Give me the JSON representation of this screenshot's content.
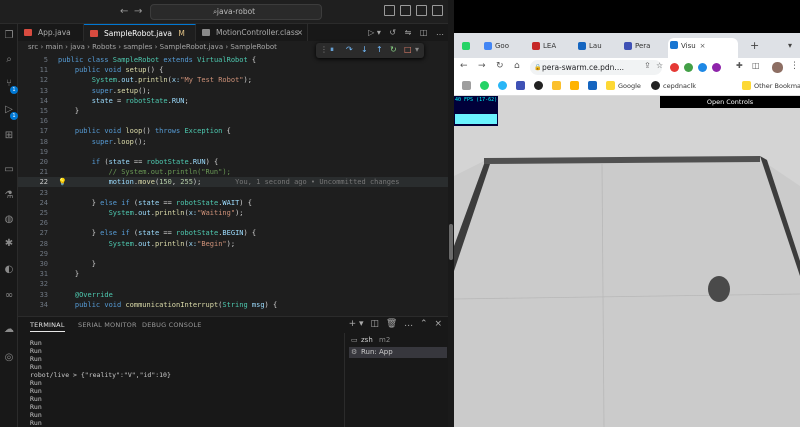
{
  "vscode": {
    "search_text": "java-robot",
    "tabs": [
      {
        "label": "App.java",
        "modified": ""
      },
      {
        "label": "SampleRobot.java",
        "modified": "M"
      },
      {
        "label": "MotionController.class",
        "modified": ""
      }
    ],
    "breadcrumb": "src › main › java › Robots › samples › SampleRobot.java › SampleRobot",
    "activity_badges": {
      "source_control": "1",
      "run": "1"
    },
    "code_lines": [
      {
        "n": "5",
        "html": "<span class='kw'>public class</span> <span class='ty'>SampleRobot</span> <span class='kw'>extends</span> <span class='ty'>VirtualRobot</span> {"
      },
      {
        "n": "11",
        "html": "    <span class='kw'>public void</span> <span class='fn'>setup</span>() {"
      },
      {
        "n": "12",
        "html": "        <span class='ty'>System</span>.<span class='par'>out</span>.<span class='fn'>println</span>(<span class='par'>x:</span><span class='str'>\"My Test Robot\"</span>);"
      },
      {
        "n": "13",
        "html": "        <span class='kw'>super</span>.<span class='fn'>setup</span>();"
      },
      {
        "n": "14",
        "html": "        <span class='par'>state</span> = <span class='ty'>robotState</span>.<span class='par'>RUN</span>;"
      },
      {
        "n": "15",
        "html": "    }"
      },
      {
        "n": "16",
        "html": ""
      },
      {
        "n": "17",
        "html": "    <span class='kw'>public void</span> <span class='fn'>loop</span>() <span class='kw'>throws</span> <span class='ty'>Exception</span> {"
      },
      {
        "n": "18",
        "html": "        <span class='kw'>super</span>.<span class='fn'>loop</span>();"
      },
      {
        "n": "19",
        "html": ""
      },
      {
        "n": "20",
        "html": "        <span class='kw'>if</span> (<span class='par'>state</span> == <span class='ty'>robotState</span>.<span class='par'>RUN</span>) {"
      },
      {
        "n": "21",
        "html": "            <span class='cm'>// System.out.println(\"Run\");</span>"
      },
      {
        "n": "22",
        "html": "            <span class='par'>motion</span>.<span class='fn'>move</span>(<span class='num'>150</span>, <span class='num'>255</span>);        <span class='lens'>You, 1 second ago • Uncommitted changes</span>"
      },
      {
        "n": "23",
        "html": ""
      },
      {
        "n": "24",
        "html": "        } <span class='kw'>else if</span> (<span class='par'>state</span> == <span class='ty'>robotState</span>.<span class='par'>WAIT</span>) {"
      },
      {
        "n": "25",
        "html": "            <span class='ty'>System</span>.<span class='par'>out</span>.<span class='fn'>println</span>(<span class='par'>x:</span><span class='str'>\"Waiting\"</span>);"
      },
      {
        "n": "26",
        "html": ""
      },
      {
        "n": "27",
        "html": "        } <span class='kw'>else if</span> (<span class='par'>state</span> == <span class='ty'>robotState</span>.<span class='par'>BEGIN</span>) {"
      },
      {
        "n": "28",
        "html": "            <span class='ty'>System</span>.<span class='par'>out</span>.<span class='fn'>println</span>(<span class='par'>x:</span><span class='str'>\"Begin\"</span>);"
      },
      {
        "n": "29",
        "html": ""
      },
      {
        "n": "30",
        "html": "        }"
      },
      {
        "n": "31",
        "html": "    }"
      },
      {
        "n": "32",
        "html": ""
      },
      {
        "n": "33",
        "html": "    <span class='ty'>@Override</span>"
      },
      {
        "n": "34",
        "html": "    <span class='kw'>public void</span> <span class='fn'>communicationInterrupt</span>(<span class='ty'>String</span> <span class='par'>msg</span>) {"
      }
    ],
    "panel_tabs": [
      "TERMINAL",
      "SERIAL MONITOR",
      "DEBUG CONSOLE"
    ],
    "terminal_output": "Run\nRun\nRun\nRun\nrobot/live > {\"reality\":\"V\",\"id\":10}\nRun\nRun\nRun\nRun\nRun\nRun",
    "terminals": [
      {
        "label": "zsh",
        "suffix": "m2"
      },
      {
        "label": "Run: App",
        "suffix": ""
      }
    ]
  },
  "chrome": {
    "tabs": [
      {
        "label": "",
        "color": "#25d366"
      },
      {
        "label": "Goo",
        "color": "#4285f4"
      },
      {
        "label": "LEA",
        "color": "#c62828"
      },
      {
        "label": "Lau",
        "color": "#1565c0"
      },
      {
        "label": "Pera",
        "color": "#3f51b5"
      },
      {
        "label": "Visu",
        "color": "#1976d2"
      }
    ],
    "url": "pera-swarm.ce.pdn....",
    "bookmarks": [
      "Google",
      "cepdnaclk"
    ],
    "other_bookmarks": "Other Bookmarks",
    "fps_label": "40 FPS (17-62)",
    "fps_fraction": 0.3,
    "open_controls": "Open Controls"
  }
}
